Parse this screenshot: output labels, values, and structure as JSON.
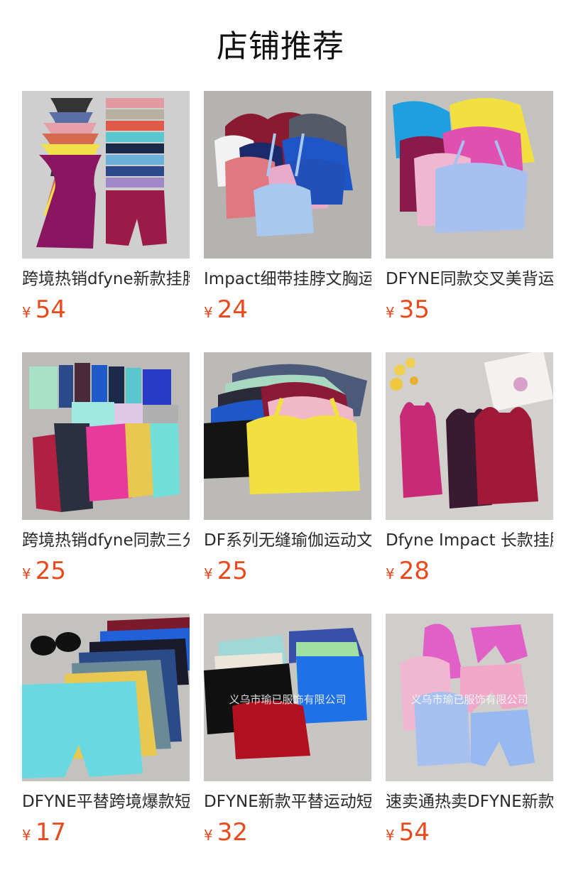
{
  "header": {
    "title": "店铺推荐"
  },
  "products": [
    {
      "name": "跨境热销dfyne新款挂脖运动背心",
      "currency": "¥",
      "price": "54",
      "image": "product-photo"
    },
    {
      "name": "Impact细带挂脖文胸运动内衣",
      "currency": "¥",
      "price": "24",
      "image": "product-photo"
    },
    {
      "name": "DFYNE同款交叉美背运动文胸",
      "currency": "¥",
      "price": "35",
      "image": "product-photo"
    },
    {
      "name": "跨境热销dfyne同款三分短裤",
      "currency": "¥",
      "price": "25",
      "image": "product-photo"
    },
    {
      "name": "DF系列无缝瑜伽运动文胸",
      "currency": "¥",
      "price": "25",
      "image": "product-photo"
    },
    {
      "name": "Dfyne Impact 长款挂脖背心",
      "currency": "¥",
      "price": "28",
      "image": "product-photo"
    },
    {
      "name": "DFYNE平替跨境爆款短裤",
      "currency": "¥",
      "price": "17",
      "image": "product-photo"
    },
    {
      "name": "DFYNE新款平替运动短袖",
      "currency": "¥",
      "price": "32",
      "image": "product-photo"
    },
    {
      "name": "速卖通热卖DFYNE新款套装",
      "currency": "¥",
      "price": "54",
      "image": "product-photo"
    }
  ],
  "watermarks": {
    "p8": "义乌市瑜已服饰有限公司",
    "p9": "义乌市瑜已服饰有限公司"
  },
  "colors": {
    "price": "#e8491d",
    "title": "#111111",
    "text": "#2a2a2a"
  }
}
